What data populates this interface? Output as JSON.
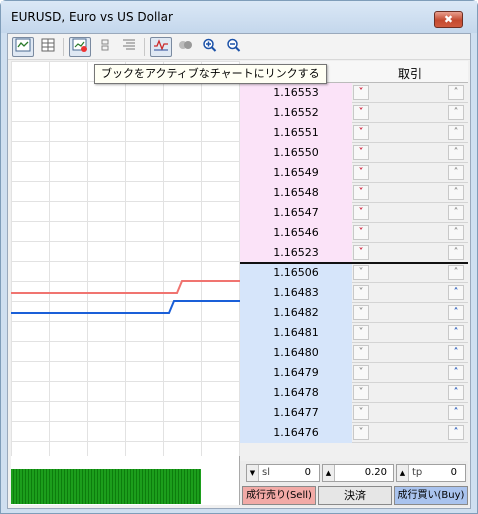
{
  "window": {
    "title": "EURUSD, Euro vs US Dollar",
    "close_glyph": "✖"
  },
  "toolbar": {
    "icons": [
      "tick-chart-icon",
      "depth-table-icon",
      "link-chart-icon",
      "stack-icon",
      "volume-icon",
      "auto-scroll-icon",
      "dots-icon",
      "zoom-in-icon",
      "zoom-out-icon"
    ]
  },
  "tooltip": "ブックをアクティブなチャートにリンクする",
  "book": {
    "header": "取引",
    "sell_rows": [
      "1.16553",
      "1.16552",
      "1.16551",
      "1.16550",
      "1.16549",
      "1.16548",
      "1.16547",
      "1.16546",
      "1.16523"
    ],
    "buy_rows": [
      "1.16506",
      "1.16483",
      "1.16482",
      "1.16481",
      "1.16480",
      "1.16479",
      "1.16478",
      "1.16477",
      "1.16476"
    ]
  },
  "order": {
    "sl_label": "sl",
    "sl_value": "0",
    "volume_value": "0.20",
    "tp_label": "tp",
    "tp_value": "0",
    "sell_button": "成行売り(Sell)",
    "close_button": "決済",
    "buy_button": "成行買い(Buy)"
  },
  "colors": {
    "ask_line": "#f07470",
    "bid_line": "#1a5fd8",
    "sell_row": "#fbe3f8",
    "buy_row": "#d6e5fa",
    "histogram": "#1c9e1c",
    "down_arrow": "#c8102e",
    "up_arrow": "#1a4fb4"
  }
}
